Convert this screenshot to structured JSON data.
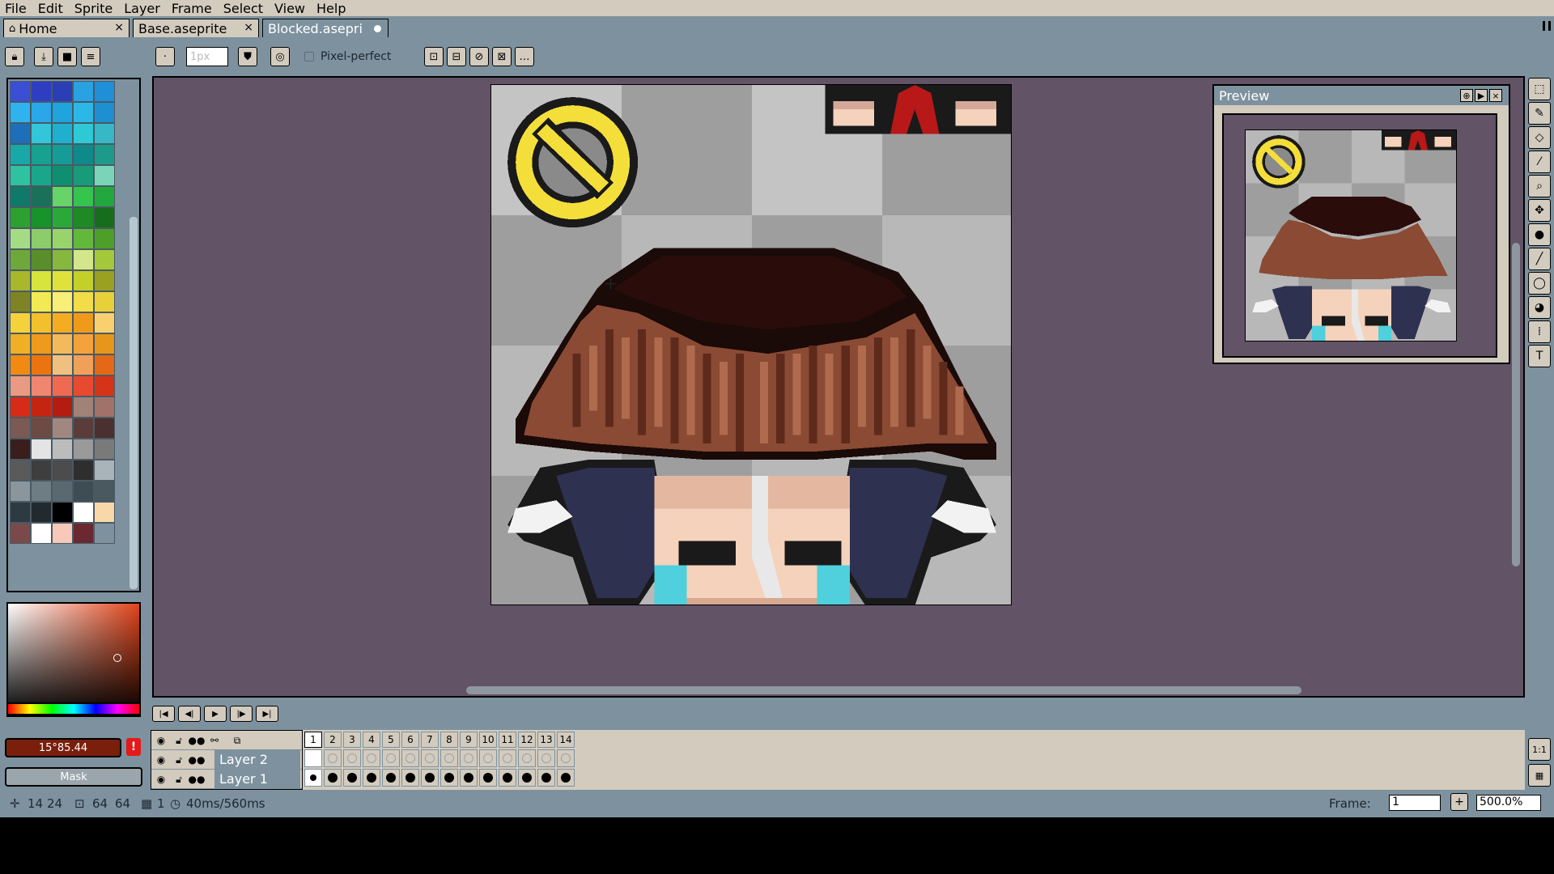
{
  "menu": [
    "File",
    "Edit",
    "Sprite",
    "Layer",
    "Frame",
    "Select",
    "View",
    "Help"
  ],
  "tabs": [
    {
      "label": "Home",
      "icon": "home-icon",
      "close": "×"
    },
    {
      "label": "Base.aseprite",
      "close": "×"
    },
    {
      "label": "Blocked.asepri",
      "modified": true
    }
  ],
  "toolbar": {
    "brush_size_placeholder": "1px",
    "pixel_perfect_label": "Pixel-perfect"
  },
  "palette": {
    "colors": [
      "#3b4fd6",
      "#2e3ec2",
      "#2a3fb5",
      "#28a2e3",
      "#1f8fd8",
      "#2fb3ee",
      "#2aa7e8",
      "#1fa4de",
      "#2cb8e6",
      "#1e8fd0",
      "#1c6fb8",
      "#33c6da",
      "#1fb0cf",
      "#2dcad6",
      "#36b8c6",
      "#19a8a8",
      "#18a090",
      "#159c96",
      "#0f8a8a",
      "#1e9a8a",
      "#2ec2a0",
      "#1aa68a",
      "#0e9070",
      "#199a78",
      "#7cd4b8",
      "#0e7a6a",
      "#1a7058",
      "#66d466",
      "#35c44c",
      "#22a83c",
      "#2ca030",
      "#18922a",
      "#2aa83a",
      "#1e8a24",
      "#166e1c",
      "#a4dc86",
      "#8ccc6a",
      "#98d46a",
      "#62b83a",
      "#4e9e2a",
      "#6ea83a",
      "#5a8e2a",
      "#86b83e",
      "#d4e68a",
      "#a4c83a",
      "#a8b82a",
      "#d6e43c",
      "#e0e23c",
      "#c4d02a",
      "#9aa022",
      "#7e8426",
      "#f2ea52",
      "#f8ee78",
      "#f2dc48",
      "#e8d03a",
      "#f6d23a",
      "#f2c02c",
      "#f4ac22",
      "#f09a1a",
      "#f8d070",
      "#f0b024",
      "#ee9a1c",
      "#f2ba5a",
      "#f4a23c",
      "#e6961a",
      "#f08a14",
      "#ec7410",
      "#f0c080",
      "#f0a058",
      "#e46818",
      "#ea9a82",
      "#f08670",
      "#f06a52",
      "#e84a30",
      "#d63418",
      "#d82a18",
      "#c42410",
      "#b41c10",
      "#a08278",
      "#a0726a",
      "#7c5a54",
      "#6e4a44",
      "#a08880",
      "#5a3c3a",
      "#4a302e",
      "#3a1e1c",
      "#e4e4e4",
      "#bcbcbc",
      "#9a9a9a",
      "#7a7a7a",
      "#5a5a5a",
      "#3e3e3e",
      "#4c4c4c",
      "#2e2e2e",
      "#a8b4ba",
      "#8a969c",
      "#6e7c84",
      "#5a6870",
      "#3e4c54",
      "#4a5860",
      "#2e3a42",
      "#222a30",
      "#000000",
      "#ffffff",
      "#f8d8a8",
      "#7a4a4a",
      "#ffffff",
      "#f8c8b8",
      "#6a2830",
      "#7d929e"
    ]
  },
  "color_field": "15°85.44",
  "mask_label": "Mask",
  "preview": {
    "title": "Preview"
  },
  "playback": [
    "first-frame",
    "previous-frame",
    "play",
    "next-frame",
    "last-frame"
  ],
  "layers": [
    {
      "name": "Layer 2"
    },
    {
      "name": "Layer 1"
    }
  ],
  "frames": [
    "1",
    "2",
    "3",
    "4",
    "5",
    "6",
    "7",
    "8",
    "9",
    "10",
    "11",
    "12",
    "13",
    "14"
  ],
  "status": {
    "pos_x": "14",
    "pos_y": "24",
    "size_w": "64",
    "size_h": "64",
    "frame_num": "1",
    "duration": "40ms/560ms",
    "frame_label": "Frame:",
    "frame_value": "1",
    "zoom": "500.0%"
  },
  "colors": {
    "ui_panel": "#7d929e",
    "ui_face": "#d3cbbe",
    "canvas_bg": "#625366",
    "hat_top": "#2a0d0a",
    "hat_brown": "#8a4a34",
    "hair": "#2e3150",
    "skin": "#f5d2bb",
    "tears": "#4fd0dc",
    "sign_yellow": "#f4de3a"
  }
}
